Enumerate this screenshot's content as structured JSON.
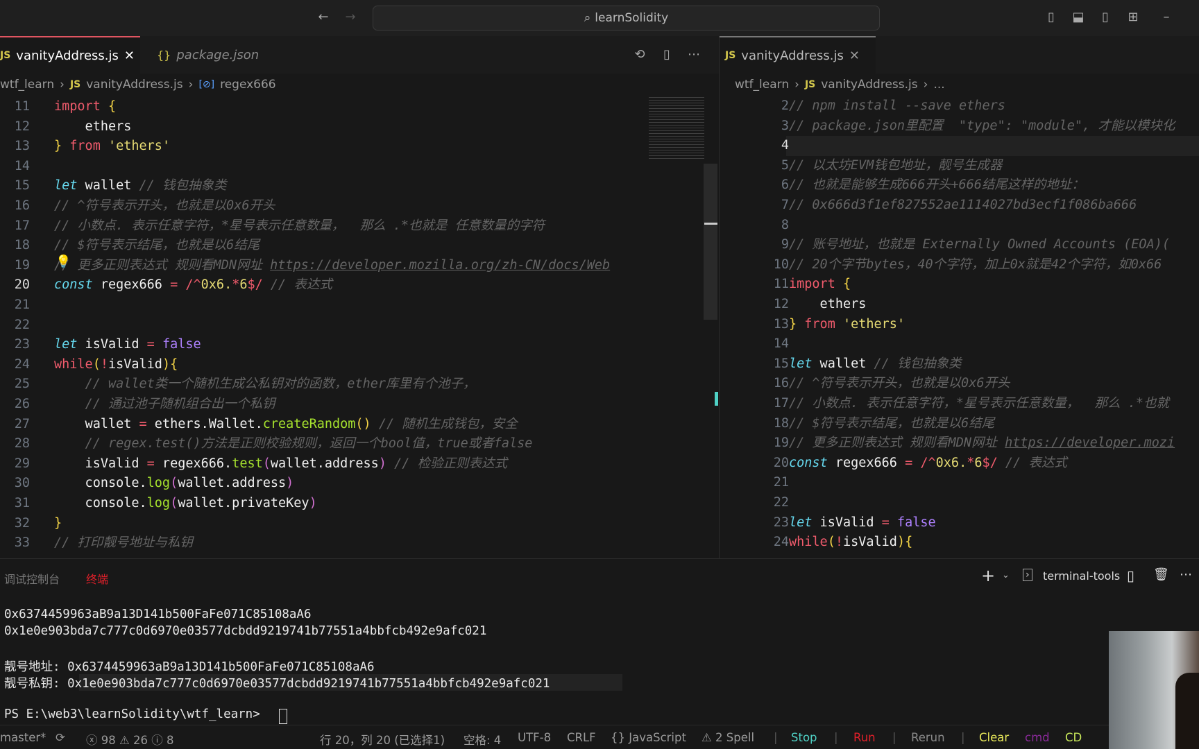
{
  "titlebar": {
    "search_text": "learnSolidity",
    "search_icon": "search-icon",
    "back_icon": "arrow-left-icon",
    "forward_icon": "arrow-right-icon",
    "layout_icons": [
      "toggle-primary-sidebar-icon",
      "toggle-panel-icon",
      "toggle-secondary-sidebar-icon",
      "customize-layout-icon",
      "minimize-icon"
    ]
  },
  "left_editor": {
    "tabs": [
      {
        "label": "vanityAddress.js",
        "icon": "JS",
        "active": true
      },
      {
        "label": "package.json",
        "icon": "{}",
        "active": false
      }
    ],
    "actions": [
      "timeline-icon",
      "split-editor-icon",
      "more-icon"
    ],
    "breadcrumb": [
      "wtf_learn",
      "vanityAddress.js",
      "regex666"
    ],
    "lines": [
      {
        "n": "11",
        "t": [
          [
            "kw",
            "import"
          ],
          [
            "pl",
            " "
          ],
          [
            "br",
            "{"
          ]
        ]
      },
      {
        "n": "12",
        "t": [
          [
            "pl",
            "    ethers"
          ]
        ]
      },
      {
        "n": "13",
        "t": [
          [
            "br",
            "}"
          ],
          [
            "pl",
            " "
          ],
          [
            "kw",
            "from"
          ],
          [
            "pl",
            " "
          ],
          [
            "str",
            "'ethers'"
          ]
        ]
      },
      {
        "n": "14",
        "t": []
      },
      {
        "n": "15",
        "t": [
          [
            "st",
            "let"
          ],
          [
            "pl",
            " wallet "
          ],
          [
            "cm",
            "// 钱包抽象类"
          ]
        ]
      },
      {
        "n": "16",
        "t": [
          [
            "cm",
            "// ^符号表示开头，也就是以0x6开头"
          ]
        ]
      },
      {
        "n": "17",
        "t": [
          [
            "cm",
            "// 小数点. 表示任意字符，*星号表示任意数量，  那么 .*也就是 任意数量的字符"
          ]
        ]
      },
      {
        "n": "18",
        "t": [
          [
            "cm",
            "// $符号表示结尾，也就是以6结尾"
          ]
        ]
      },
      {
        "n": "19",
        "t": [
          [
            "cm",
            "// 更多正则表达式 规则看MDN网址 "
          ],
          [
            "lk",
            "https://developer.mozilla.org/zh-CN/docs/Web"
          ]
        ]
      },
      {
        "n": "20",
        "t": [
          [
            "st",
            "const"
          ],
          [
            "pl",
            " regex666 "
          ],
          [
            "op",
            "="
          ],
          [
            "pl",
            " "
          ],
          [
            "rx",
            "/^"
          ],
          [
            "str",
            "0x6."
          ],
          [
            "rx",
            "*"
          ],
          [
            "str",
            "6"
          ],
          [
            "rx",
            "$/"
          ],
          [
            "pl",
            " "
          ],
          [
            "cm",
            "// 表达式"
          ]
        ]
      },
      {
        "n": "21",
        "t": []
      },
      {
        "n": "22",
        "t": []
      },
      {
        "n": "23",
        "t": [
          [
            "st",
            "let"
          ],
          [
            "pl",
            " isValid "
          ],
          [
            "op",
            "="
          ],
          [
            "pl",
            " "
          ],
          [
            "nm",
            "false"
          ]
        ]
      },
      {
        "n": "24",
        "t": [
          [
            "kw",
            "while"
          ],
          [
            "br",
            "("
          ],
          [
            "kw",
            "!"
          ],
          [
            "pl",
            "isValid"
          ],
          [
            "br",
            "){"
          ]
        ]
      },
      {
        "n": "25",
        "t": [
          [
            "pl",
            "    "
          ],
          [
            "cm",
            "// wallet类一个随机生成公私钥对的函数，ether库里有个池子，"
          ]
        ]
      },
      {
        "n": "26",
        "t": [
          [
            "pl",
            "    "
          ],
          [
            "cm",
            "// 通过池子随机组合出一个私钥"
          ]
        ]
      },
      {
        "n": "27",
        "t": [
          [
            "pl",
            "    wallet "
          ],
          [
            "op",
            "="
          ],
          [
            "pl",
            " ethers.Wallet."
          ],
          [
            "fn",
            "createRandom"
          ],
          [
            "br",
            "()"
          ],
          [
            "pl",
            " "
          ],
          [
            "cm",
            "// 随机生成钱包，安全"
          ]
        ]
      },
      {
        "n": "28",
        "t": [
          [
            "pl",
            "    "
          ],
          [
            "cm",
            "// regex.test()方法是正则校验规则，返回一个bool值，true或者false"
          ]
        ]
      },
      {
        "n": "29",
        "t": [
          [
            "pl",
            "    isValid "
          ],
          [
            "op",
            "="
          ],
          [
            "pl",
            " regex666."
          ],
          [
            "fn",
            "test"
          ],
          [
            "br2",
            "("
          ],
          [
            "pl",
            "wallet.address"
          ],
          [
            "br2",
            ")"
          ],
          [
            "pl",
            " "
          ],
          [
            "cm",
            "// 检验正则表达式"
          ]
        ]
      },
      {
        "n": "30",
        "t": [
          [
            "pl",
            "    console."
          ],
          [
            "fn",
            "log"
          ],
          [
            "br2",
            "("
          ],
          [
            "pl",
            "wallet.address"
          ],
          [
            "br2",
            ")"
          ]
        ]
      },
      {
        "n": "31",
        "t": [
          [
            "pl",
            "    console."
          ],
          [
            "fn",
            "log"
          ],
          [
            "br2",
            "("
          ],
          [
            "pl",
            "wallet.privateKey"
          ],
          [
            "br2",
            ")"
          ]
        ]
      },
      {
        "n": "32",
        "t": [
          [
            "br",
            "}"
          ]
        ]
      },
      {
        "n": "33",
        "t": [
          [
            "cm",
            "// 打印靓号地址与私钥"
          ]
        ]
      }
    ],
    "current_line": "20"
  },
  "right_editor": {
    "tabs": [
      {
        "label": "vanityAddress.js",
        "icon": "JS",
        "active": true
      }
    ],
    "breadcrumb": [
      "wtf_learn",
      "vanityAddress.js",
      "..."
    ],
    "lines": [
      {
        "n": "2",
        "t": [
          [
            "cm",
            "// npm install --save ethers"
          ]
        ]
      },
      {
        "n": "3",
        "t": [
          [
            "cm",
            "// package.json里配置  \"type\": \"module\", 才能以模块化"
          ]
        ]
      },
      {
        "n": "4",
        "t": []
      },
      {
        "n": "5",
        "t": [
          [
            "cm",
            "// 以太坊EVM钱包地址，靓号生成器"
          ]
        ]
      },
      {
        "n": "6",
        "t": [
          [
            "cm",
            "// 也就是能够生成666开头+666结尾这样的地址："
          ]
        ]
      },
      {
        "n": "7",
        "t": [
          [
            "cm",
            "// 0x666d3f1ef827552ae1114027bd3ecf1f086ba666"
          ]
        ]
      },
      {
        "n": "8",
        "t": []
      },
      {
        "n": "9",
        "t": [
          [
            "cm",
            "// 账号地址，也就是 Externally Owned Accounts (EOA)("
          ]
        ]
      },
      {
        "n": "10",
        "t": [
          [
            "cm",
            "// 20个字节bytes，40个字符，加上0x就是42个字符，如0x66"
          ]
        ]
      },
      {
        "n": "11",
        "t": [
          [
            "kw",
            "import"
          ],
          [
            "pl",
            " "
          ],
          [
            "br",
            "{"
          ]
        ]
      },
      {
        "n": "12",
        "t": [
          [
            "pl",
            "    ethers"
          ]
        ]
      },
      {
        "n": "13",
        "t": [
          [
            "br",
            "}"
          ],
          [
            "pl",
            " "
          ],
          [
            "kw",
            "from"
          ],
          [
            "pl",
            " "
          ],
          [
            "str",
            "'ethers'"
          ]
        ]
      },
      {
        "n": "14",
        "t": []
      },
      {
        "n": "15",
        "t": [
          [
            "st",
            "let"
          ],
          [
            "pl",
            " wallet "
          ],
          [
            "cm",
            "// 钱包抽象类"
          ]
        ]
      },
      {
        "n": "16",
        "t": [
          [
            "cm",
            "// ^符号表示开头，也就是以0x6开头"
          ]
        ]
      },
      {
        "n": "17",
        "t": [
          [
            "cm",
            "// 小数点. 表示任意字符，*星号表示任意数量，  那么 .*也就"
          ]
        ]
      },
      {
        "n": "18",
        "t": [
          [
            "cm",
            "// $符号表示结尾，也就是以6结尾"
          ]
        ]
      },
      {
        "n": "19",
        "t": [
          [
            "cm",
            "// 更多正则表达式 规则看MDN网址 "
          ],
          [
            "lk",
            "https://developer.mozi"
          ]
        ]
      },
      {
        "n": "20",
        "t": [
          [
            "st",
            "const"
          ],
          [
            "pl",
            " regex666 "
          ],
          [
            "op",
            "="
          ],
          [
            "pl",
            " "
          ],
          [
            "rx",
            "/^"
          ],
          [
            "str",
            "0x6."
          ],
          [
            "rx",
            "*"
          ],
          [
            "str",
            "6"
          ],
          [
            "rx",
            "$/"
          ],
          [
            "pl",
            " "
          ],
          [
            "cm",
            "// 表达式"
          ]
        ]
      },
      {
        "n": "21",
        "t": []
      },
      {
        "n": "22",
        "t": []
      },
      {
        "n": "23",
        "t": [
          [
            "st",
            "let"
          ],
          [
            "pl",
            " isValid "
          ],
          [
            "op",
            "="
          ],
          [
            "pl",
            " "
          ],
          [
            "nm",
            "false"
          ]
        ]
      },
      {
        "n": "24",
        "t": [
          [
            "kw",
            "while"
          ],
          [
            "br",
            "("
          ],
          [
            "kw",
            "!"
          ],
          [
            "pl",
            "isValid"
          ],
          [
            "br",
            "){"
          ]
        ]
      }
    ],
    "current_line": "4"
  },
  "panel": {
    "tabs": [
      {
        "label": "调试控制台",
        "active": false
      },
      {
        "label": "终端",
        "active": true
      }
    ],
    "terminal_name": "terminal-tools",
    "actions": [
      "new-terminal-icon",
      "chevron-down-icon",
      "split-terminal-icon",
      "trash-icon",
      "more-icon"
    ],
    "lines": [
      "0x6374459963aB9a13D141b500FaFe071C85108aA6",
      "0x1e0e903bda7c777c0d6970e03577dcbdd9219741b77551a4bbfcb492e9afc021",
      "",
      "靓号地址: 0x6374459963aB9a13D141b500FaFe071C85108aA6",
      "靓号私钥: 0x1e0e903bda7c777c0d6970e03577dcbdd9219741b77551a4bbfcb492e9afc021",
      "",
      "PS E:\\web3\\learnSolidity\\wtf_learn> "
    ]
  },
  "statusbar": {
    "branch": "master*",
    "errors": "98",
    "warnings": "26",
    "infos": "8",
    "position": "行 20，列 20 (已选择1)",
    "indent": "空格: 4",
    "encoding": "UTF-8",
    "eol": "CRLF",
    "language": "{} JavaScript",
    "spell": "⚠ 2 Spell",
    "buttons": [
      {
        "label": "Stop",
        "color": "#4fd1c5"
      },
      {
        "label": "Run",
        "color": "#e0202a"
      },
      {
        "label": "Rerun",
        "color": "#8a8a8a"
      },
      {
        "label": "Clear",
        "color": "#e8e85a"
      },
      {
        "label": "cmd",
        "color": "#8a2a9a"
      },
      {
        "label": "CD",
        "color": "#c8e85a"
      }
    ]
  }
}
